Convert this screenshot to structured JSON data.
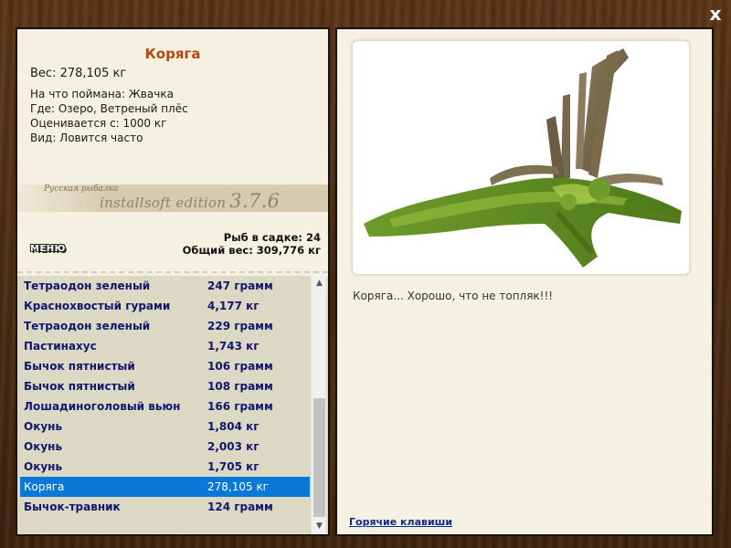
{
  "window": {
    "close_label": "x"
  },
  "catch": {
    "name": "Коряга",
    "weight": "Вес: 278,105 кг",
    "info": [
      "На что поймана: Жвачка",
      "Где: Озеро, Ветреный плёс",
      "Оценивается с: 1000 кг",
      "Вид: Ловится часто"
    ]
  },
  "branding": {
    "logo_script": "Русская рыбалка",
    "edition": "installsoft edition",
    "version": "3.7.6"
  },
  "stats": {
    "fish_in_keepnet": "Рыб в садке: 24",
    "total_weight": "Общий вес: 309,776 кг"
  },
  "menu_label": "МЕНЮ",
  "keepnet": {
    "rows": [
      {
        "name": "Тетраодон зеленый",
        "weight": "247 грамм"
      },
      {
        "name": "Краснохвостый гурами",
        "weight": "4,177 кг"
      },
      {
        "name": "Тетраодон зеленый",
        "weight": "229 грамм"
      },
      {
        "name": "Пастинахус",
        "weight": "1,743 кг"
      },
      {
        "name": "Бычок пятнистый",
        "weight": "106 грамм"
      },
      {
        "name": "Бычок пятнистый",
        "weight": "108 грамм"
      },
      {
        "name": "Лошадиноголовый вьюн",
        "weight": "166 грамм"
      },
      {
        "name": "Окунь",
        "weight": "1,804 кг"
      },
      {
        "name": "Окунь",
        "weight": "2,003 кг"
      },
      {
        "name": "Окунь",
        "weight": "1,705 кг"
      },
      {
        "name": "Коряга",
        "weight": "278,105 кг"
      },
      {
        "name": "Бычок-травник",
        "weight": "124 грамм"
      }
    ],
    "selected_index": 10
  },
  "scrollbar": {
    "up_icon": "triangle-up-icon",
    "down_icon": "triangle-down-icon"
  },
  "photo": {
    "subject_icon": "mossy-snag-image"
  },
  "caption": "Коряга... Хорошо, что не топляк!!!",
  "hotkeys_label": "Горячие клавиши",
  "colors": {
    "name_accent": "#b5470f",
    "list_text": "#14166e",
    "selected_row": "#0a78d6",
    "panel_bg": "#f4f1e2",
    "list_bg": "#dbd8c4",
    "link": "#102a8a"
  }
}
